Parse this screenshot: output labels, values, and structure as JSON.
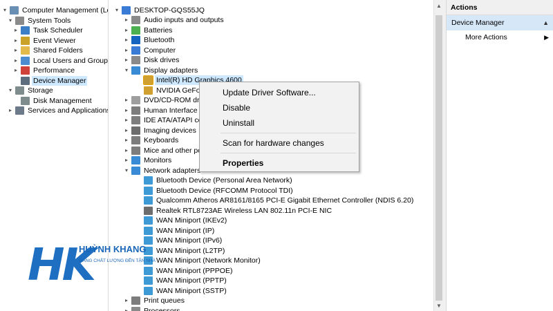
{
  "left_tree": {
    "items": [
      {
        "label": "Computer Management (Local",
        "expander": "chevron-down",
        "icon": "computer-management-icon"
      },
      {
        "label": "System Tools",
        "expander": "chevron-down",
        "icon": "tools-icon"
      },
      {
        "label": "Task Scheduler",
        "expander": "chevron-right",
        "icon": "clock-icon"
      },
      {
        "label": "Event Viewer",
        "expander": "chevron-right",
        "icon": "event-viewer-icon"
      },
      {
        "label": "Shared Folders",
        "expander": "chevron-right",
        "icon": "shared-folder-icon"
      },
      {
        "label": "Local Users and Groups",
        "expander": "chevron-right",
        "icon": "users-icon"
      },
      {
        "label": "Performance",
        "expander": "chevron-right",
        "icon": "performance-icon"
      },
      {
        "label": "Device Manager",
        "expander": "",
        "icon": "device-manager-icon",
        "selected": true
      },
      {
        "label": "Storage",
        "expander": "chevron-down",
        "icon": "storage-icon"
      },
      {
        "label": "Disk Management",
        "expander": "",
        "icon": "disk-management-icon"
      },
      {
        "label": "Services and Applications",
        "expander": "chevron-right",
        "icon": "services-icon"
      }
    ]
  },
  "device_tree": {
    "root": "DESKTOP-GQS55JQ",
    "items": [
      {
        "label": "Audio inputs and outputs",
        "expander": "chevron-right",
        "icon": "audio-icon"
      },
      {
        "label": "Batteries",
        "expander": "chevron-right",
        "icon": "battery-icon"
      },
      {
        "label": "Bluetooth",
        "expander": "chevron-right",
        "icon": "bluetooth-icon"
      },
      {
        "label": "Computer",
        "expander": "chevron-right",
        "icon": "computer-icon"
      },
      {
        "label": "Disk drives",
        "expander": "chevron-right",
        "icon": "disk-drive-icon"
      },
      {
        "label": "Display adapters",
        "expander": "chevron-down",
        "icon": "display-adapter-icon"
      },
      {
        "label": "Intel(R) HD Graphics 4600",
        "expander": "",
        "icon": "display-device-icon",
        "child": true,
        "highlighted": true
      },
      {
        "label": "NVIDIA GeFor",
        "expander": "",
        "icon": "display-device-icon",
        "child": true
      },
      {
        "label": "DVD/CD-ROM driv",
        "expander": "chevron-right",
        "icon": "dvd-icon"
      },
      {
        "label": "Human Interface D",
        "expander": "chevron-right",
        "icon": "hid-icon"
      },
      {
        "label": "IDE ATA/ATAPI con",
        "expander": "chevron-right",
        "icon": "ide-icon"
      },
      {
        "label": "Imaging devices",
        "expander": "chevron-right",
        "icon": "camera-icon"
      },
      {
        "label": "Keyboards",
        "expander": "chevron-right",
        "icon": "keyboard-icon"
      },
      {
        "label": "Mice and other po",
        "expander": "chevron-right",
        "icon": "mouse-icon"
      },
      {
        "label": "Monitors",
        "expander": "chevron-right",
        "icon": "monitor-icon"
      },
      {
        "label": "Network adapters",
        "expander": "chevron-down",
        "icon": "network-adapter-icon"
      },
      {
        "label": "Bluetooth Device (Personal Area Network)",
        "expander": "",
        "icon": "network-device-icon",
        "child": true
      },
      {
        "label": "Bluetooth Device (RFCOMM Protocol TDI)",
        "expander": "",
        "icon": "network-device-icon",
        "child": true
      },
      {
        "label": "Qualcomm Atheros AR8161/8165 PCI-E Gigabit Ethernet Controller (NDIS 6.20)",
        "expander": "",
        "icon": "network-device-icon",
        "child": true
      },
      {
        "label": "Realtek RTL8723AE Wireless LAN 802.11n PCI-E NIC",
        "expander": "",
        "icon": "wireless-device-icon",
        "child": true
      },
      {
        "label": "WAN Miniport (IKEv2)",
        "expander": "",
        "icon": "network-device-icon",
        "child": true
      },
      {
        "label": "WAN Miniport (IP)",
        "expander": "",
        "icon": "network-device-icon",
        "child": true
      },
      {
        "label": "WAN Miniport (IPv6)",
        "expander": "",
        "icon": "network-device-icon",
        "child": true
      },
      {
        "label": "WAN Miniport (L2TP)",
        "expander": "",
        "icon": "network-device-icon",
        "child": true
      },
      {
        "label": "WAN Miniport (Network Monitor)",
        "expander": "",
        "icon": "network-device-icon",
        "child": true
      },
      {
        "label": "WAN Miniport (PPPOE)",
        "expander": "",
        "icon": "network-device-icon",
        "child": true
      },
      {
        "label": "WAN Miniport (PPTP)",
        "expander": "",
        "icon": "network-device-icon",
        "child": true
      },
      {
        "label": "WAN Miniport (SSTP)",
        "expander": "",
        "icon": "network-device-icon",
        "child": true
      },
      {
        "label": "Print queues",
        "expander": "chevron-right",
        "icon": "printer-icon"
      },
      {
        "label": "Processors",
        "expander": "chevron-right",
        "icon": "processor-icon"
      }
    ]
  },
  "context_menu": {
    "items": [
      {
        "label": "Update Driver Software...",
        "bold": false
      },
      {
        "label": "Disable",
        "bold": false
      },
      {
        "label": "Uninstall",
        "bold": false
      },
      {
        "label": "Scan for hardware changes",
        "bold": false
      },
      {
        "label": "Properties",
        "bold": true
      }
    ]
  },
  "actions": {
    "header": "Actions",
    "section": "Device Manager",
    "item": "More Actions"
  },
  "logo": {
    "letters": "HK",
    "name": "HUỲNH KHANG",
    "tagline": "MANG CHẤT LƯỢNG ĐẾN TẬN NHÀ"
  },
  "colors": {
    "selection": "#cde8ff",
    "actions_section": "#d6e7f8",
    "logo_blue": "#1e6fc1"
  }
}
